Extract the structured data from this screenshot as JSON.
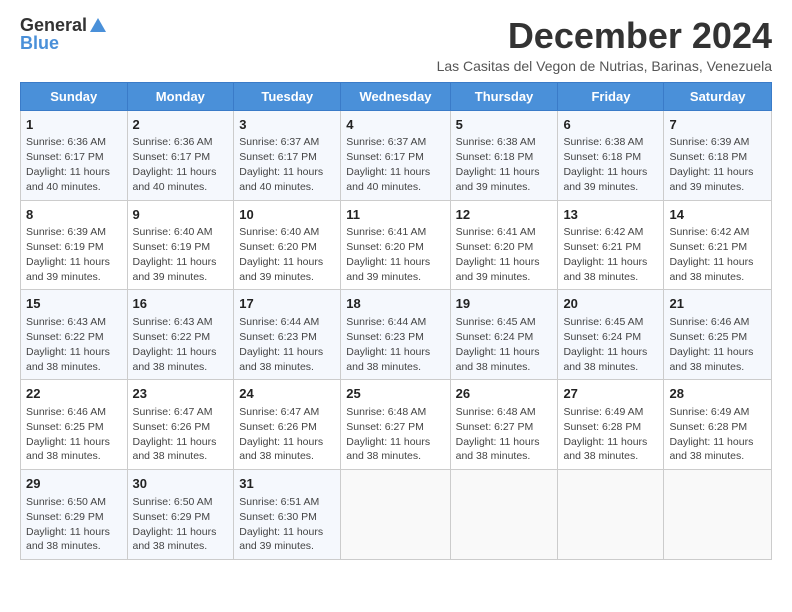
{
  "header": {
    "logo_general": "General",
    "logo_blue": "Blue",
    "month_title": "December 2024",
    "location": "Las Casitas del Vegon de Nutrias, Barinas, Venezuela"
  },
  "calendar": {
    "days_of_week": [
      "Sunday",
      "Monday",
      "Tuesday",
      "Wednesday",
      "Thursday",
      "Friday",
      "Saturday"
    ],
    "weeks": [
      [
        {
          "day": "1",
          "sunrise": "6:36 AM",
          "sunset": "6:17 PM",
          "daylight": "11 hours and 40 minutes."
        },
        {
          "day": "2",
          "sunrise": "6:36 AM",
          "sunset": "6:17 PM",
          "daylight": "11 hours and 40 minutes."
        },
        {
          "day": "3",
          "sunrise": "6:37 AM",
          "sunset": "6:17 PM",
          "daylight": "11 hours and 40 minutes."
        },
        {
          "day": "4",
          "sunrise": "6:37 AM",
          "sunset": "6:17 PM",
          "daylight": "11 hours and 40 minutes."
        },
        {
          "day": "5",
          "sunrise": "6:38 AM",
          "sunset": "6:18 PM",
          "daylight": "11 hours and 39 minutes."
        },
        {
          "day": "6",
          "sunrise": "6:38 AM",
          "sunset": "6:18 PM",
          "daylight": "11 hours and 39 minutes."
        },
        {
          "day": "7",
          "sunrise": "6:39 AM",
          "sunset": "6:18 PM",
          "daylight": "11 hours and 39 minutes."
        }
      ],
      [
        {
          "day": "8",
          "sunrise": "6:39 AM",
          "sunset": "6:19 PM",
          "daylight": "11 hours and 39 minutes."
        },
        {
          "day": "9",
          "sunrise": "6:40 AM",
          "sunset": "6:19 PM",
          "daylight": "11 hours and 39 minutes."
        },
        {
          "day": "10",
          "sunrise": "6:40 AM",
          "sunset": "6:20 PM",
          "daylight": "11 hours and 39 minutes."
        },
        {
          "day": "11",
          "sunrise": "6:41 AM",
          "sunset": "6:20 PM",
          "daylight": "11 hours and 39 minutes."
        },
        {
          "day": "12",
          "sunrise": "6:41 AM",
          "sunset": "6:20 PM",
          "daylight": "11 hours and 39 minutes."
        },
        {
          "day": "13",
          "sunrise": "6:42 AM",
          "sunset": "6:21 PM",
          "daylight": "11 hours and 38 minutes."
        },
        {
          "day": "14",
          "sunrise": "6:42 AM",
          "sunset": "6:21 PM",
          "daylight": "11 hours and 38 minutes."
        }
      ],
      [
        {
          "day": "15",
          "sunrise": "6:43 AM",
          "sunset": "6:22 PM",
          "daylight": "11 hours and 38 minutes."
        },
        {
          "day": "16",
          "sunrise": "6:43 AM",
          "sunset": "6:22 PM",
          "daylight": "11 hours and 38 minutes."
        },
        {
          "day": "17",
          "sunrise": "6:44 AM",
          "sunset": "6:23 PM",
          "daylight": "11 hours and 38 minutes."
        },
        {
          "day": "18",
          "sunrise": "6:44 AM",
          "sunset": "6:23 PM",
          "daylight": "11 hours and 38 minutes."
        },
        {
          "day": "19",
          "sunrise": "6:45 AM",
          "sunset": "6:24 PM",
          "daylight": "11 hours and 38 minutes."
        },
        {
          "day": "20",
          "sunrise": "6:45 AM",
          "sunset": "6:24 PM",
          "daylight": "11 hours and 38 minutes."
        },
        {
          "day": "21",
          "sunrise": "6:46 AM",
          "sunset": "6:25 PM",
          "daylight": "11 hours and 38 minutes."
        }
      ],
      [
        {
          "day": "22",
          "sunrise": "6:46 AM",
          "sunset": "6:25 PM",
          "daylight": "11 hours and 38 minutes."
        },
        {
          "day": "23",
          "sunrise": "6:47 AM",
          "sunset": "6:26 PM",
          "daylight": "11 hours and 38 minutes."
        },
        {
          "day": "24",
          "sunrise": "6:47 AM",
          "sunset": "6:26 PM",
          "daylight": "11 hours and 38 minutes."
        },
        {
          "day": "25",
          "sunrise": "6:48 AM",
          "sunset": "6:27 PM",
          "daylight": "11 hours and 38 minutes."
        },
        {
          "day": "26",
          "sunrise": "6:48 AM",
          "sunset": "6:27 PM",
          "daylight": "11 hours and 38 minutes."
        },
        {
          "day": "27",
          "sunrise": "6:49 AM",
          "sunset": "6:28 PM",
          "daylight": "11 hours and 38 minutes."
        },
        {
          "day": "28",
          "sunrise": "6:49 AM",
          "sunset": "6:28 PM",
          "daylight": "11 hours and 38 minutes."
        }
      ],
      [
        {
          "day": "29",
          "sunrise": "6:50 AM",
          "sunset": "6:29 PM",
          "daylight": "11 hours and 38 minutes."
        },
        {
          "day": "30",
          "sunrise": "6:50 AM",
          "sunset": "6:29 PM",
          "daylight": "11 hours and 38 minutes."
        },
        {
          "day": "31",
          "sunrise": "6:51 AM",
          "sunset": "6:30 PM",
          "daylight": "11 hours and 39 minutes."
        },
        null,
        null,
        null,
        null
      ]
    ]
  }
}
